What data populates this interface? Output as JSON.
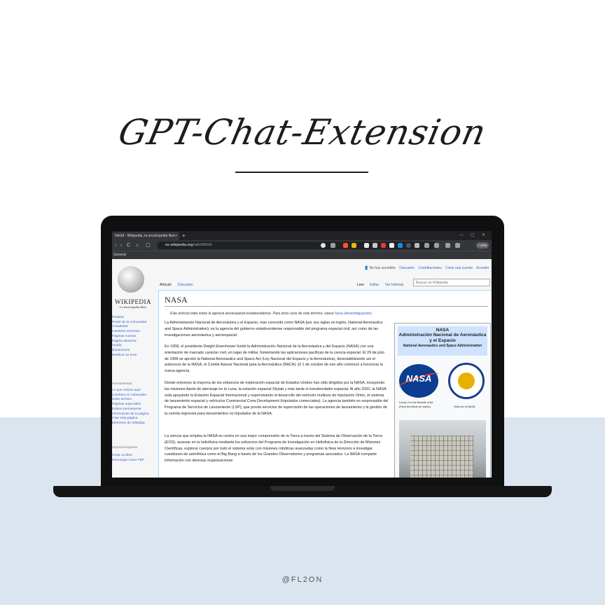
{
  "poster": {
    "title": "GPT-Chat-Extension",
    "handle": "@FL2ON"
  },
  "browser": {
    "tab_title": "NASA - Wikipedia, la enciclopedia libre",
    "tab_close": "×",
    "new_tab": "+",
    "url_domain": "es.wikipedia.org",
    "url_path": "/wiki/NASA",
    "vpn_label": "• VPN",
    "bookmark_label": "General",
    "nav_icons": [
      "‹",
      "›",
      "C",
      "⌂",
      "▢"
    ]
  },
  "wiki": {
    "logo_word": "WIKIPEDIA",
    "logo_sub": "La enciclopedia libre",
    "user_nav": {
      "not_logged": "No has accedido",
      "links": [
        "Discusión",
        "Contribuciones",
        "Crear una cuenta",
        "Acceder"
      ]
    },
    "page_tabs": [
      "Artículo",
      "Discusión"
    ],
    "view_tabs": [
      "Leer",
      "Editar",
      "Ver historial"
    ],
    "search_placeholder": "Buscar en Wikipedia",
    "sidebar_nav": [
      "Portada",
      "Portal de la comunidad",
      "Actualidad",
      "Cambios recientes",
      "Páginas nuevas",
      "Página aleatoria",
      "Ayuda",
      "Donaciones",
      "Notificar un error"
    ],
    "sidebar_tools_heading": "Herramientas",
    "sidebar_tools": [
      "Lo que enlaza aquí",
      "Cambios en enlazadas",
      "Subir archivo",
      "Páginas especiales",
      "Enlace permanente",
      "Información de la página",
      "Citar esta página",
      "Elemento de Wikidata"
    ],
    "sidebar_export_heading": "Imprimir/exportar",
    "sidebar_export": [
      "Crear un libro",
      "Descargar como PDF"
    ],
    "page_title": "NASA",
    "hatnote_text": "Este artículo trata sobre la agencia aeroespacial estadounidense. Para otros usos de este término, véase",
    "hatnote_link": "Nasa (desambiguación).",
    "paragraphs": [
      "La Administración Nacional de Aeronáutica y el Espacio, más conocida como NASA (por sus siglas en inglés, National Aeronautics and Space Administration), es la agencia del gobierno estadounidense responsable del programa espacial civil, así como de las investigaciones aeronáutica y aeroespacial.",
      "En 1958, el presidente Dwight Eisenhower fundó la Administración Nacional de la Aeronáutica y del Espacio (NASA) con una orientación de marcado carácter civil, en lugar de militar, fomentando las aplicaciones pacíficas de la ciencia espacial. El 29 de julio de 1958 se aprobó la National Aeronautics and Space Act (Ley Nacional del Espacio y la Aeronáutica), desestabilizando así el antecesor de la NASA, el Comité Asesor Nacional para la Aeronáutica (NACA). El 1 de octubre de ese año comenzó a funcionar la nueva agencia.",
      "Desde entonces la mayoría de los esfuerzos de exploración espacial de Estados Unidos han sido dirigidos por la NASA, incluyendo las misiones Apolo de aterrizaje en la Luna, la estación espacial Skylab y más tarde el transbordador espacial. Al año 2020, la NASA está apoyando la Estación Espacial Internacional y supervisando el desarrollo del vehículo multiuso de tripulación Orión, el sistema de lanzamiento espacial y vehículos Commercial Crew Development (tripulados comerciales). La agencia también es responsable del Programa de Servicios de Lanzamiento (LSP), que presta servicios de supervisión de las operaciones de lanzamiento y la gestión de la cuenta regresiva para lanzamientos no tripulados de la NASA.",
      "La ciencia que emplea la NASA se centra en una mejor comprensión de la Tierra a través del Sistema de Observación de la Tierra (EOS), avanzar en la heliofísica mediante los esfuerzos del Programa de Investigación en Heliofísica de la Dirección de Misiones Científicas, explorar cuerpos por todo el sistema solar con misiones robóticas avanzadas como la New Horizons e investigar cuestiones de astrofísica como el Big Bang a través de los Grandes Observatorios y programas asociados. La NASA comparte información con diversas organizaciones"
    ],
    "infobox": {
      "name": "NASA",
      "title": "Administración Nacional de Aeronáutica y el Espacio",
      "english": "National Aeronautics and Space Administration",
      "meatball_text": "NASA",
      "lema": "Lema: For the Benefit of All",
      "lema_es": "(Para beneficio de todos)",
      "seal_caption": "Sello de la NASA"
    }
  }
}
